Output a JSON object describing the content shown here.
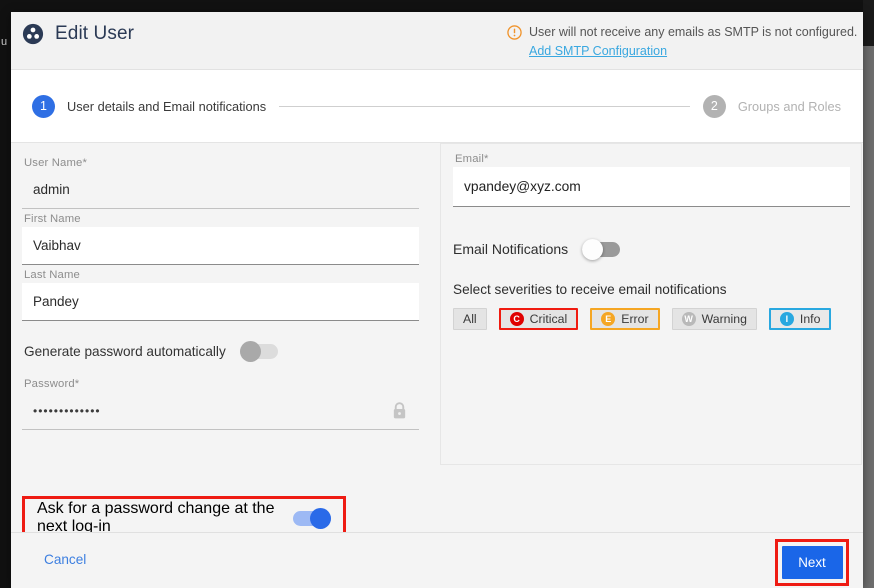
{
  "window": {
    "background_behind_text": "u"
  },
  "header": {
    "icon": "users-group-icon",
    "title": "Edit User",
    "warning": {
      "icon": "warning-circle-icon",
      "text": "User will not receive any emails as SMTP is not configured.",
      "link": "Add SMTP Configuration"
    }
  },
  "stepper": {
    "steps": [
      {
        "number": "1",
        "label": "User details and Email notifications",
        "state": "active"
      },
      {
        "number": "2",
        "label": "Groups and Roles",
        "state": "inactive"
      }
    ]
  },
  "form": {
    "user_name": {
      "label": "User Name*",
      "value": "admin",
      "placeholder": "User Name"
    },
    "first_name": {
      "label": "First Name",
      "value": "Vaibhav",
      "placeholder": "First Name"
    },
    "last_name": {
      "label": "Last Name",
      "value": "Pandey",
      "placeholder": "Last Name"
    },
    "generate_password": {
      "label": "Generate password automatically",
      "state": "off"
    },
    "password": {
      "label": "Password*",
      "value": "•••••••••••••",
      "icon": "lock-icon"
    },
    "ask_password_change": {
      "label": "Ask for a password change at the next log-in",
      "state": "on"
    }
  },
  "email_panel": {
    "email": {
      "label": "Email*",
      "value": "vpandey@xyz.com",
      "placeholder": "Email"
    },
    "email_notifications": {
      "label": "Email Notifications",
      "state": "off"
    },
    "severity_title": "Select severities to receive email notifications",
    "severities": [
      {
        "label": "All",
        "badge": "",
        "selected": false,
        "color": ""
      },
      {
        "label": "Critical",
        "badge": "C",
        "selected": true,
        "color": "#e00000"
      },
      {
        "label": "Error",
        "badge": "E",
        "selected": true,
        "color": "#f5a623"
      },
      {
        "label": "Warning",
        "badge": "W",
        "selected": false,
        "color": "#b9b9b9"
      },
      {
        "label": "Info",
        "badge": "I",
        "selected": true,
        "color": "#29a8e0"
      }
    ]
  },
  "footer": {
    "cancel_label": "Cancel",
    "next_label": "Next"
  },
  "colors": {
    "accent_blue": "#1a66e8",
    "link_blue": "#3aa8e0",
    "highlight_red": "#ee1b13",
    "step_active": "#2f6fe4",
    "step_inactive": "#b2b2b2"
  }
}
